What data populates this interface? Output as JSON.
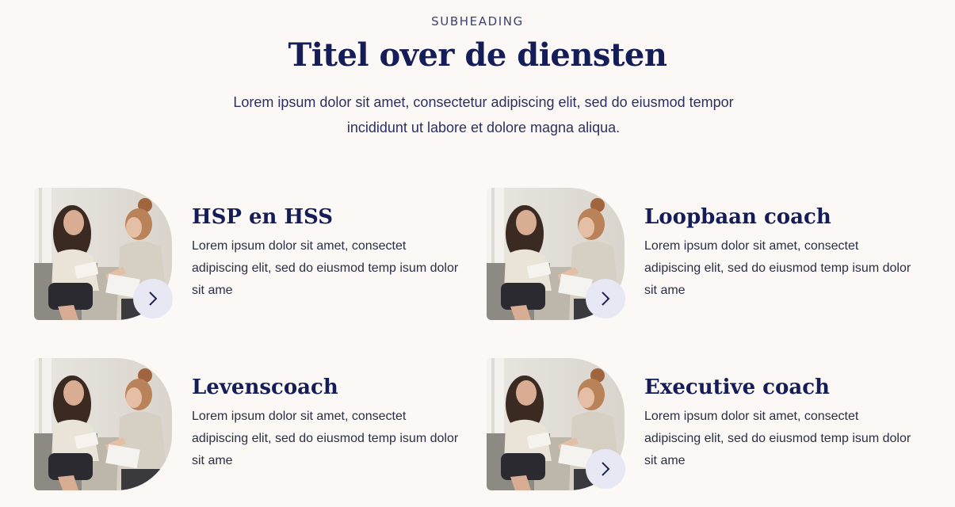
{
  "header": {
    "subheading": "SUBHEADING",
    "title": "Titel over de diensten",
    "intro": "Lorem ipsum dolor sit amet, consectetur adipiscing elit, sed do eiusmod tempor incididunt ut labore et dolore magna aliqua."
  },
  "services": [
    {
      "title": "HSP en HSS",
      "text": "Lorem ipsum dolor sit amet, consectet adipiscing elit, sed do eiusmod temp isum dolor sit ame",
      "image": "two-women-coaching-photo",
      "button_icon": "chevron-right-icon"
    },
    {
      "title": "Loopbaan coach",
      "text": "Lorem ipsum dolor sit amet, consectet adipiscing elit, sed do eiusmod temp isum dolor sit ame",
      "image": "two-women-coaching-photo",
      "button_icon": "chevron-right-icon"
    },
    {
      "title": "Levenscoach",
      "text": "Lorem ipsum dolor sit amet, consectet adipiscing elit, sed do eiusmod temp isum dolor sit ame",
      "image": "two-women-coaching-photo",
      "button_icon": null
    },
    {
      "title": "Executive coach",
      "text": "Lorem ipsum dolor sit amet, consectet adipiscing elit, sed do eiusmod temp isum dolor sit ame",
      "image": "two-women-coaching-photo",
      "button_icon": "chevron-right-icon"
    }
  ],
  "colors": {
    "background": "#fcf8f5",
    "heading": "#141d57",
    "body_text": "#2b2f45",
    "button_bg": "#e7e8f3"
  }
}
